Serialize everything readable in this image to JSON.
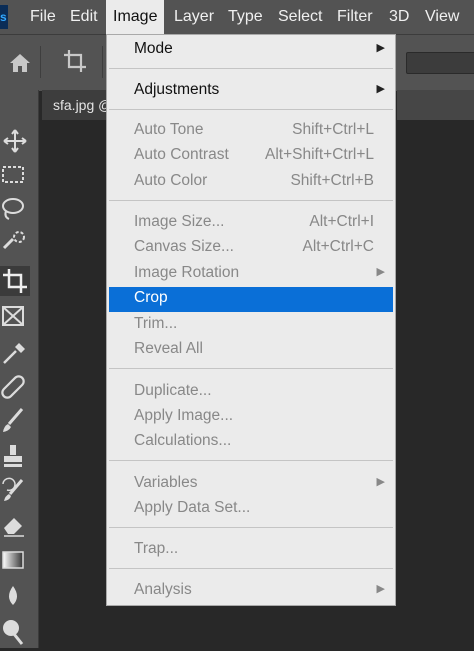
{
  "menubar": {
    "logo": "s",
    "items": [
      "File",
      "Edit",
      "Image",
      "Layer",
      "Type",
      "Select",
      "Filter",
      "3D",
      "View"
    ],
    "active": "Image"
  },
  "document_tab": {
    "label": "sfa.jpg @"
  },
  "image_menu": {
    "items": [
      {
        "label": "Mode",
        "submenu": true,
        "enabled": true
      },
      {
        "label": "Adjustments",
        "submenu": true,
        "enabled": true
      },
      {
        "label": "Auto Tone",
        "shortcut": "Shift+Ctrl+L",
        "enabled": false
      },
      {
        "label": "Auto Contrast",
        "shortcut": "Alt+Shift+Ctrl+L",
        "enabled": false
      },
      {
        "label": "Auto Color",
        "shortcut": "Shift+Ctrl+B",
        "enabled": false
      },
      {
        "label": "Image Size...",
        "shortcut": "Alt+Ctrl+I",
        "enabled": false
      },
      {
        "label": "Canvas Size...",
        "shortcut": "Alt+Ctrl+C",
        "enabled": false
      },
      {
        "label": "Image Rotation",
        "submenu": true,
        "enabled": false
      },
      {
        "label": "Crop",
        "enabled": true,
        "highlighted": true
      },
      {
        "label": "Trim...",
        "enabled": false
      },
      {
        "label": "Reveal All",
        "enabled": false
      },
      {
        "label": "Duplicate...",
        "enabled": false
      },
      {
        "label": "Apply Image...",
        "enabled": false
      },
      {
        "label": "Calculations...",
        "enabled": false
      },
      {
        "label": "Variables",
        "submenu": true,
        "enabled": false
      },
      {
        "label": "Apply Data Set...",
        "enabled": false
      },
      {
        "label": "Trap...",
        "enabled": false
      },
      {
        "label": "Analysis",
        "submenu": true,
        "enabled": false
      }
    ]
  },
  "colors": {
    "highlight": "#0a6fd7",
    "menu_bg": "#ebebeb",
    "chrome": "#535353"
  }
}
